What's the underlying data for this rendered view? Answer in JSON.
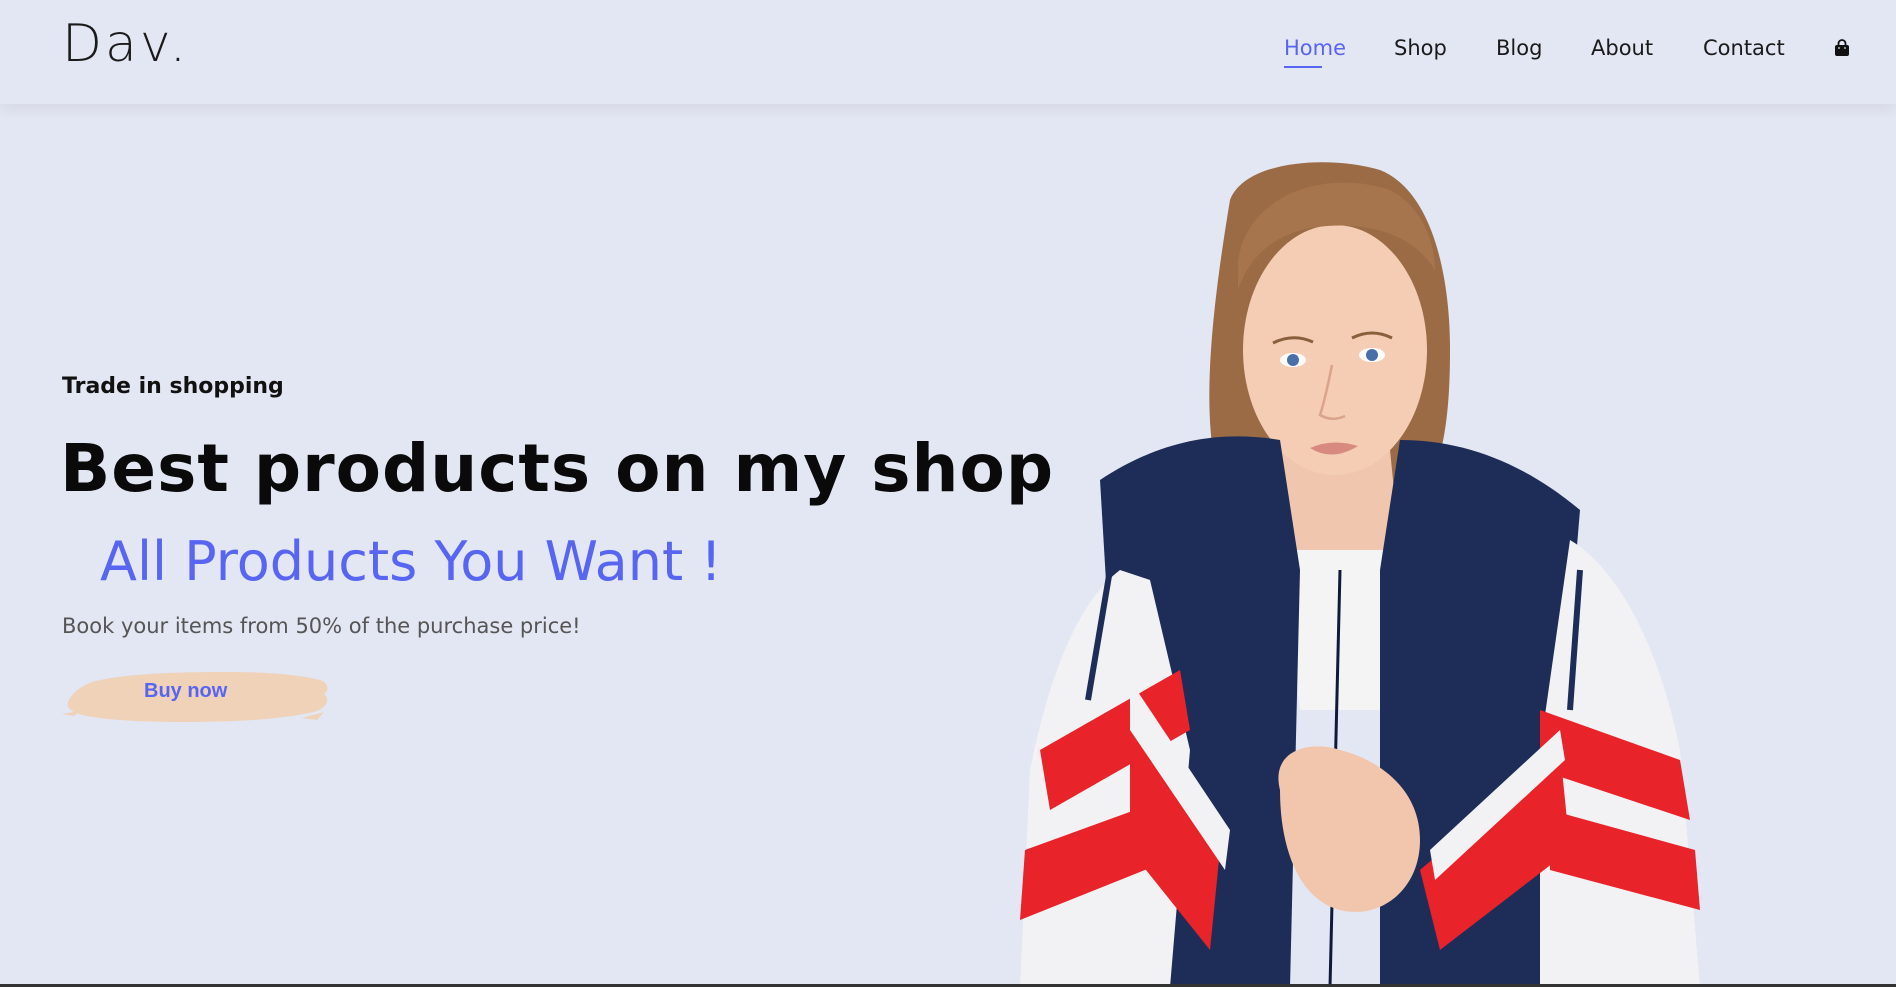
{
  "logo": "Dav.",
  "nav": {
    "items": [
      "Home",
      "Shop",
      "Blog",
      "About",
      "Contact"
    ],
    "active": "Home",
    "cart_icon": "shopping-bag-icon"
  },
  "hero": {
    "eyebrow": "Trade in shopping",
    "title": "Best products on my shop",
    "subtitle": "All Products You Want !",
    "description": "Book your items from 50% of the purchase price!",
    "cta_label": "Buy now"
  },
  "colors": {
    "background": "#e3e6f3",
    "accent": "#5865f2",
    "button_brush": "#efd2b8",
    "jacket_navy": "#1d2d58",
    "jacket_red": "#e8232a",
    "jacket_white": "#f2f2f4"
  }
}
